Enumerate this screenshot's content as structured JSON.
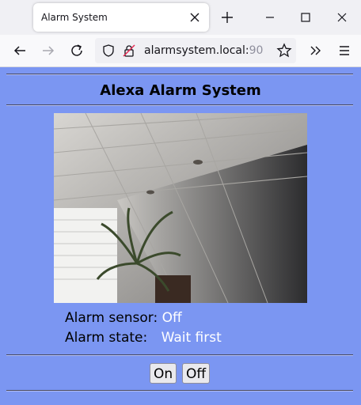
{
  "browser": {
    "tab_title": "Alarm System",
    "url_host": "alarmsystem.local:",
    "url_port": "90",
    "icons": [
      "close-icon",
      "plus-icon",
      "minimize-icon",
      "maximize-icon",
      "back-icon",
      "forward-icon",
      "reload-icon",
      "shield-icon",
      "insecure-lock-icon",
      "star-icon",
      "chevrons-icon",
      "menu-icon"
    ]
  },
  "page": {
    "title": "Alexa Alarm System",
    "sensor_label": "Alarm sensor:",
    "sensor_value": "Off",
    "state_label": "Alarm state:",
    "state_value": "Wait first",
    "on_label": "On",
    "off_label": "Off",
    "background_color": "#7b96f2"
  }
}
